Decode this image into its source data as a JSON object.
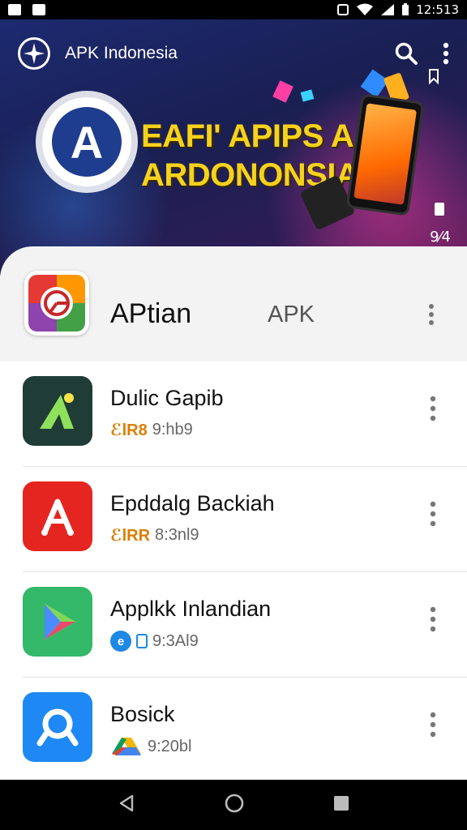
{
  "status_bar": {
    "time": "12:513"
  },
  "app_bar": {
    "title": "APK Indonesia",
    "logo_icon": "compass-logo-icon",
    "search_icon": "search-icon",
    "menu_icon": "more-vert-icon"
  },
  "hero": {
    "emblem_letter": "A",
    "headline_line1": "EAFI' APIPS A",
    "headline_line2": "ARDONONSIA",
    "side_text": "9⁄4"
  },
  "featured": {
    "name": "APtian",
    "tag": "APK"
  },
  "apps": [
    {
      "name": "Dulic Gapib",
      "tag": "ℰlR8",
      "meta": "9:hb9",
      "icon": "green-arrow-app-icon",
      "icon_bg": "#1f3d36"
    },
    {
      "name": "Epddalg Backiah",
      "tag": "ℰlRR",
      "meta": "8:3nl9",
      "icon": "red-a-app-icon",
      "icon_bg": "#e52620"
    },
    {
      "name": "Applkk Inlandian",
      "tag": "",
      "meta": "9:3Al9",
      "icon": "play-store-app-icon",
      "icon_bg": "#34b869"
    },
    {
      "name": "Bosick",
      "tag": "",
      "meta": "9:20bl",
      "icon": "blue-search-app-icon",
      "icon_bg": "#1e88f5"
    }
  ],
  "nav": {
    "back": "back-icon",
    "home": "home-icon",
    "recents": "recents-icon"
  }
}
